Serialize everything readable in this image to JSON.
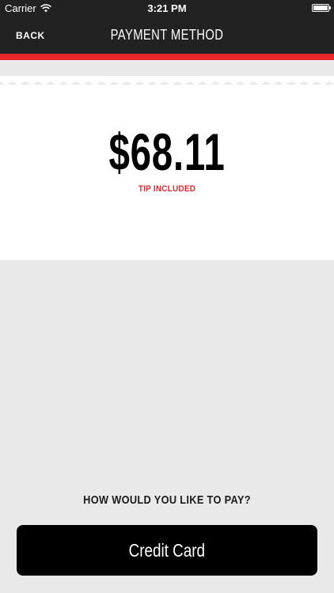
{
  "status_bar": {
    "carrier": "Carrier",
    "time": "3:21 PM",
    "battery_level": 1.0
  },
  "nav": {
    "back_label": "BACK",
    "title": "PAYMENT METHOD"
  },
  "summary": {
    "amount": "$68.11",
    "tip_note": "TIP INCLUDED"
  },
  "payment": {
    "question": "HOW WOULD YOU LIKE TO PAY?",
    "credit_card_label": "Credit Card"
  },
  "colors": {
    "accent_red": "#e8262b",
    "nav_background": "#222222",
    "page_background": "#e9e9e9",
    "button_background": "#000000"
  }
}
